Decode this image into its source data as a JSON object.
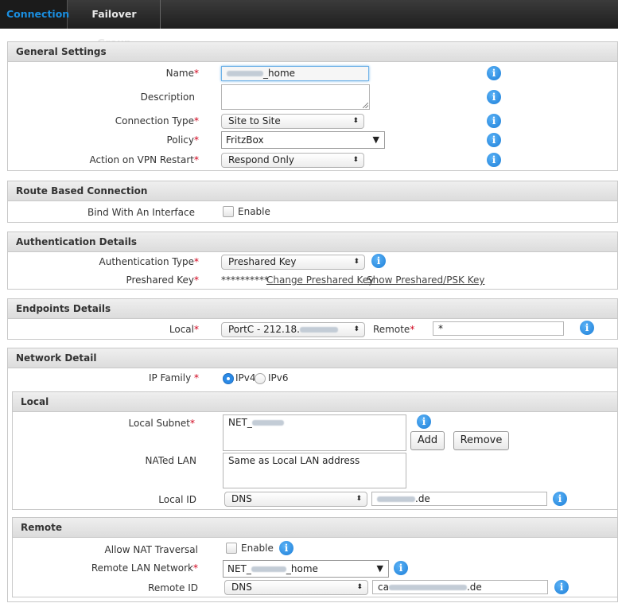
{
  "tabs": [
    {
      "label": "Connection"
    },
    {
      "label": "Failover Group"
    }
  ],
  "general": {
    "title": "General Settings",
    "name_label": "Name",
    "name_value": "_home",
    "description_label": "Description",
    "description_value": "",
    "connection_type_label": "Connection Type",
    "connection_type_value": "Site to Site",
    "policy_label": "Policy",
    "policy_value": "FritzBox",
    "action_label": "Action on VPN Restart",
    "action_value": "Respond Only"
  },
  "route": {
    "title": "Route Based Connection",
    "bind_label": "Bind With An Interface",
    "enable_label": "Enable"
  },
  "auth": {
    "title": "Authentication Details",
    "type_label": "Authentication Type",
    "type_value": "Preshared Key",
    "key_label": "Preshared Key",
    "key_mask": "**********",
    "change_link": "Change Preshared Key",
    "show_link": "Show Preshared/PSK Key"
  },
  "endpoints": {
    "title": "Endpoints Details",
    "local_label": "Local",
    "local_value": "PortC - 212.18.",
    "remote_label": "Remote",
    "remote_value": "*"
  },
  "network": {
    "title": "Network Detail",
    "ip_family_label": "IP Family",
    "ipv4_label": "IPv4",
    "ipv6_label": "IPv6"
  },
  "local": {
    "title": "Local",
    "subnet_label": "Local Subnet",
    "subnet_value": "NET_",
    "add_label": "Add",
    "remove_label": "Remove",
    "nated_label": "NATed LAN",
    "nated_value": "Same as Local LAN address",
    "id_label": "Local ID",
    "id_type": "DNS",
    "id_value": ".de"
  },
  "remote": {
    "title": "Remote",
    "nat_label": "Allow NAT Traversal",
    "enable_label": "Enable",
    "lan_label": "Remote LAN Network",
    "lan_value_prefix": "NET_",
    "lan_value_suffix": "_home",
    "id_label": "Remote ID",
    "id_type": "DNS",
    "id_value_prefix": "ca",
    "id_value_suffix": ".de"
  },
  "colors": {
    "accent": "#1a8ee0",
    "required": "#d0021b",
    "info": "#1d7fd8"
  }
}
